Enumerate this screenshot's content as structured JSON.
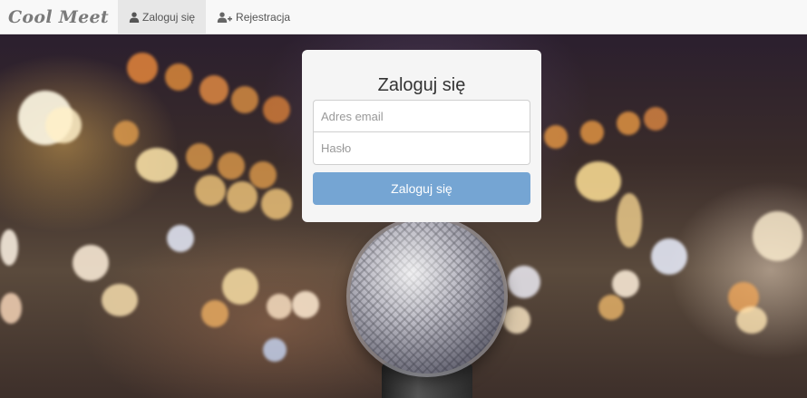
{
  "navbar": {
    "brand": "Cool Meet",
    "items": [
      {
        "label": "Zaloguj się",
        "icon": "user-icon",
        "active": true
      },
      {
        "label": "Rejestracja",
        "icon": "user-plus-icon",
        "active": false
      }
    ]
  },
  "login": {
    "title": "Zaloguj się",
    "email_placeholder": "Adres email",
    "password_placeholder": "Hasło",
    "submit_label": "Zaloguj się"
  },
  "colors": {
    "navbar_bg": "#f8f8f8",
    "active_tab_bg": "#e7e7e7",
    "submit_button": "#75a5d3",
    "panel_bg": "#f5f5f5"
  }
}
